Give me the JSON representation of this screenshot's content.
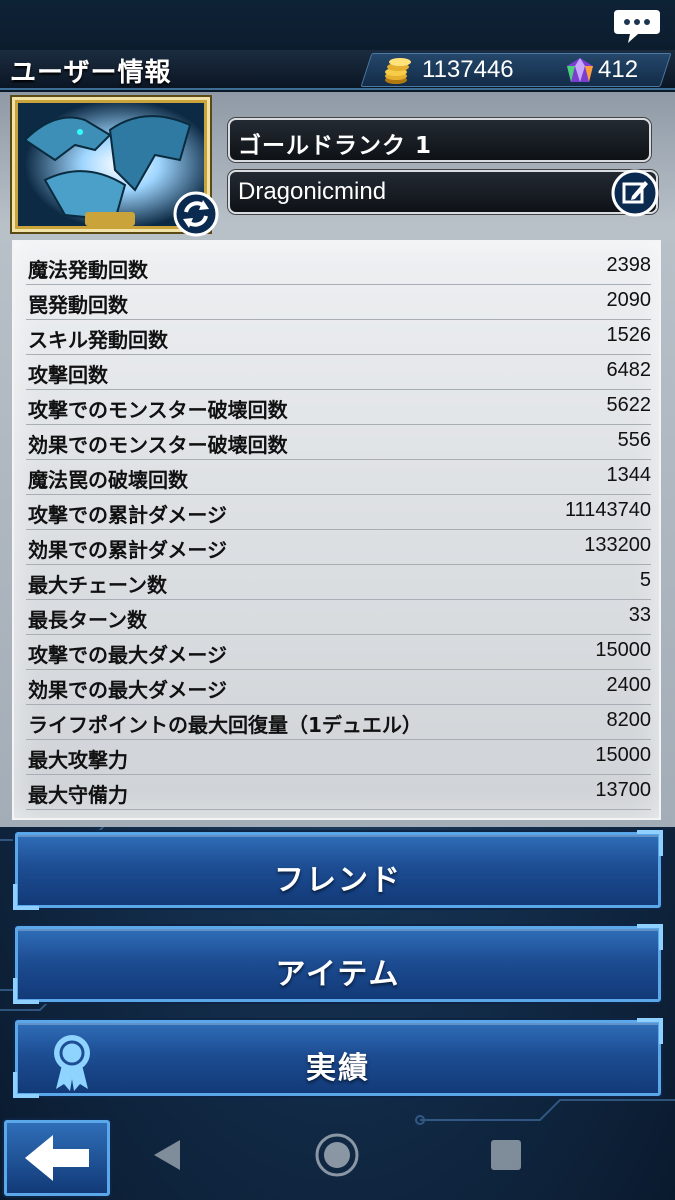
{
  "header": {
    "title": "ユーザー情報",
    "gold": "1137446",
    "gems": "412",
    "icons": {
      "chat": "chat-bubble-icon",
      "gold": "gold-coins-icon",
      "gem": "crystal-gem-icon"
    }
  },
  "profile": {
    "rank": "ゴールドランク 1",
    "name": "Dragonicmind",
    "icons": {
      "avatar": "blue-eyes-dragon-avatar",
      "refresh": "refresh-icon",
      "edit": "edit-icon"
    }
  },
  "stats": [
    {
      "label": "魔法発動回数",
      "value": "2398"
    },
    {
      "label": "罠発動回数",
      "value": "2090"
    },
    {
      "label": "スキル発動回数",
      "value": "1526"
    },
    {
      "label": "攻撃回数",
      "value": "6482"
    },
    {
      "label": "攻撃でのモンスター破壊回数",
      "value": "5622"
    },
    {
      "label": "効果でのモンスター破壊回数",
      "value": "556"
    },
    {
      "label": "魔法罠の破壊回数",
      "value": "1344"
    },
    {
      "label": "攻撃での累計ダメージ",
      "value": "11143740"
    },
    {
      "label": "効果での累計ダメージ",
      "value": "133200"
    },
    {
      "label": "最大チェーン数",
      "value": "5"
    },
    {
      "label": "最長ターン数",
      "value": "33"
    },
    {
      "label": "攻撃での最大ダメージ",
      "value": "15000"
    },
    {
      "label": "効果での最大ダメージ",
      "value": "2400"
    },
    {
      "label": "ライフポイントの最大回復量（1デュエル）",
      "value": "8200"
    },
    {
      "label": "最大攻撃力",
      "value": "15000"
    },
    {
      "label": "最大守備力",
      "value": "13700"
    }
  ],
  "buttons": {
    "friend": "フレンド",
    "item": "アイテム",
    "achievements": "実績"
  },
  "nav": {
    "back_icon": "back-arrow-icon",
    "system_back": "triangle-back-icon",
    "system_home": "circle-home-icon",
    "system_recent": "square-recents-icon"
  },
  "colors": {
    "button_blue": "#1d4d93",
    "button_border": "#5aa8ea",
    "panel": "#dfe2e5"
  }
}
